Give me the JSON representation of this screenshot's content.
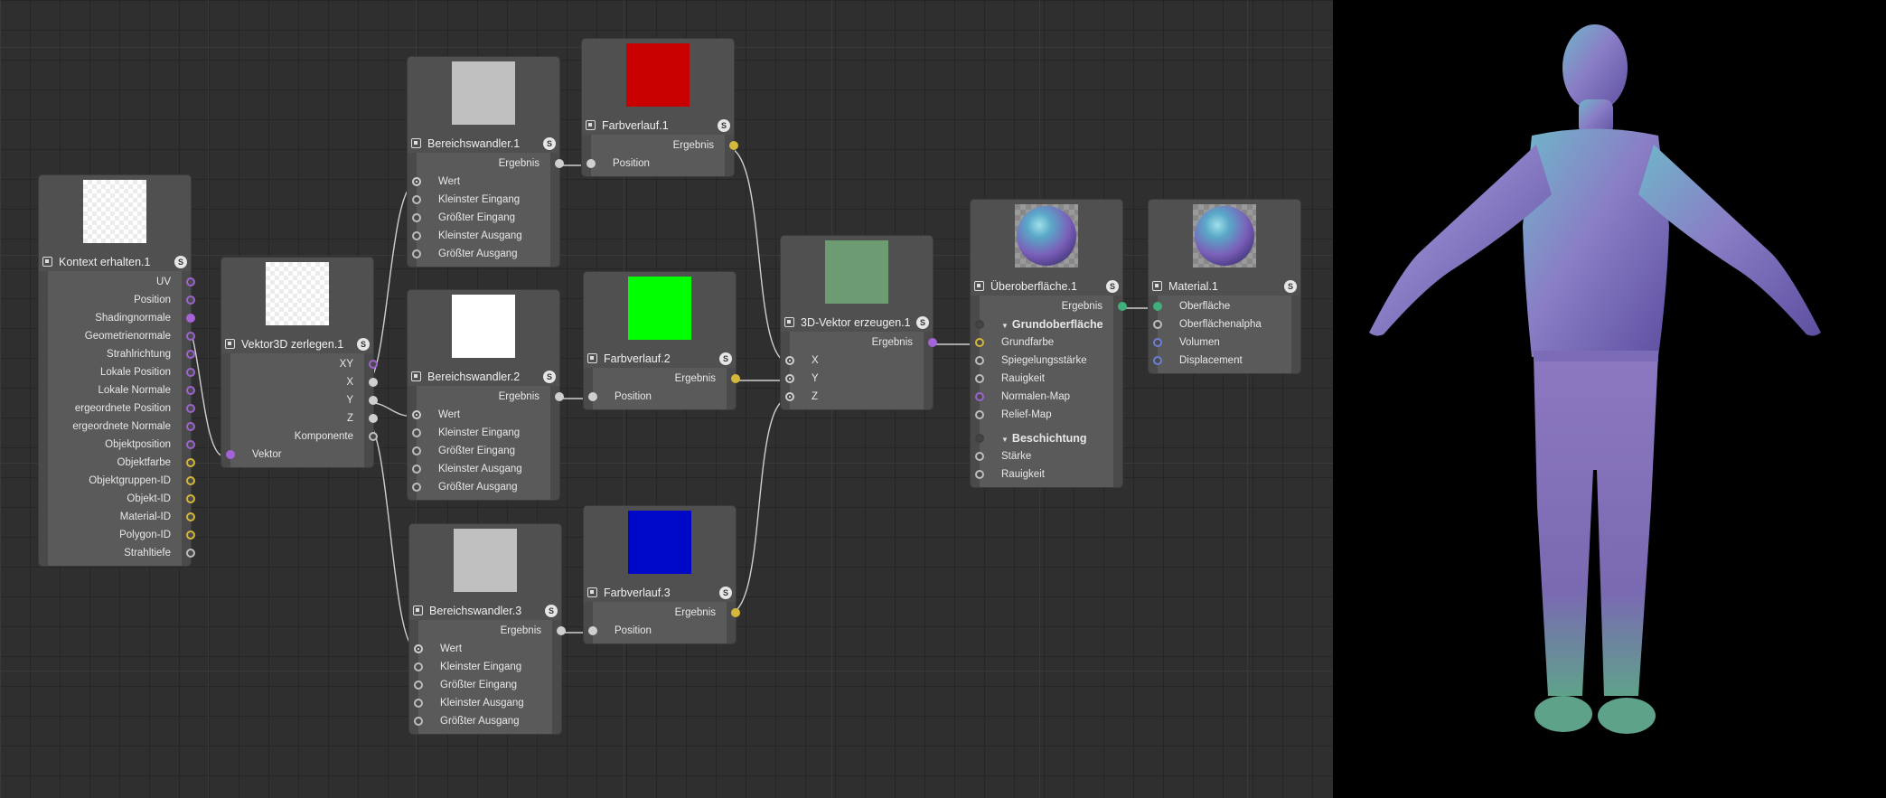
{
  "nodes": {
    "kontext": {
      "title": "Kontext erhalten.1",
      "ports": [
        "UV",
        "Position",
        "Shadingnormale",
        "Geometrienormale",
        "Strahlrichtung",
        "Lokale Position",
        "Lokale Normale",
        "ergeordnete Position",
        "ergeordnete Normale",
        "Objektposition",
        "Objektfarbe",
        "Objektgruppen-ID",
        "Objekt-ID",
        "Material-ID",
        "Polygon-ID",
        "Strahltiefe"
      ]
    },
    "vektor3d": {
      "title": "Vektor3D zerlegen.1",
      "outputs": [
        "XY",
        "X",
        "Y",
        "Z",
        "Komponente"
      ],
      "input": "Vektor"
    },
    "bw1": {
      "title": "Bereichswandler.1",
      "output": "Ergebnis",
      "inputs": [
        "Wert",
        "Kleinster Eingang",
        "Größter Eingang",
        "Kleinster Ausgang",
        "Größter Ausgang"
      ]
    },
    "bw2": {
      "title": "Bereichswandler.2",
      "output": "Ergebnis",
      "inputs": [
        "Wert",
        "Kleinster Eingang",
        "Größter Eingang",
        "Kleinster Ausgang",
        "Größter Ausgang"
      ]
    },
    "bw3": {
      "title": "Bereichswandler.3",
      "output": "Ergebnis",
      "inputs": [
        "Wert",
        "Kleinster Eingang",
        "Größter Eingang",
        "Kleinster Ausgang",
        "Größter Ausgang"
      ]
    },
    "fv1": {
      "title": "Farbverlauf.1",
      "output": "Ergebnis",
      "input": "Position",
      "color": "#c80000"
    },
    "fv2": {
      "title": "Farbverlauf.2",
      "output": "Ergebnis",
      "input": "Position",
      "color": "#00ff00"
    },
    "fv3": {
      "title": "Farbverlauf.3",
      "output": "Ergebnis",
      "input": "Position",
      "color": "#0008c8"
    },
    "vec3": {
      "title": "3D-Vektor erzeugen.1",
      "output": "Ergebnis",
      "inputs": [
        "X",
        "Y",
        "Z"
      ],
      "color": "#6d9c72"
    },
    "uber": {
      "title": "Überoberfläche.1",
      "output": "Ergebnis",
      "section1": "Grundoberfläche",
      "inputs1": [
        "Grundfarbe",
        "Spiegelungsstärke",
        "Rauigkeit",
        "Normalen-Map",
        "Relief-Map"
      ],
      "section2": "Beschichtung",
      "inputs2": [
        "Stärke",
        "Rauigkeit"
      ]
    },
    "mat": {
      "title": "Material.1",
      "inputs": [
        "Oberfläche",
        "Oberflächenalpha",
        "Volumen",
        "Displacement"
      ]
    }
  },
  "badge": "S"
}
